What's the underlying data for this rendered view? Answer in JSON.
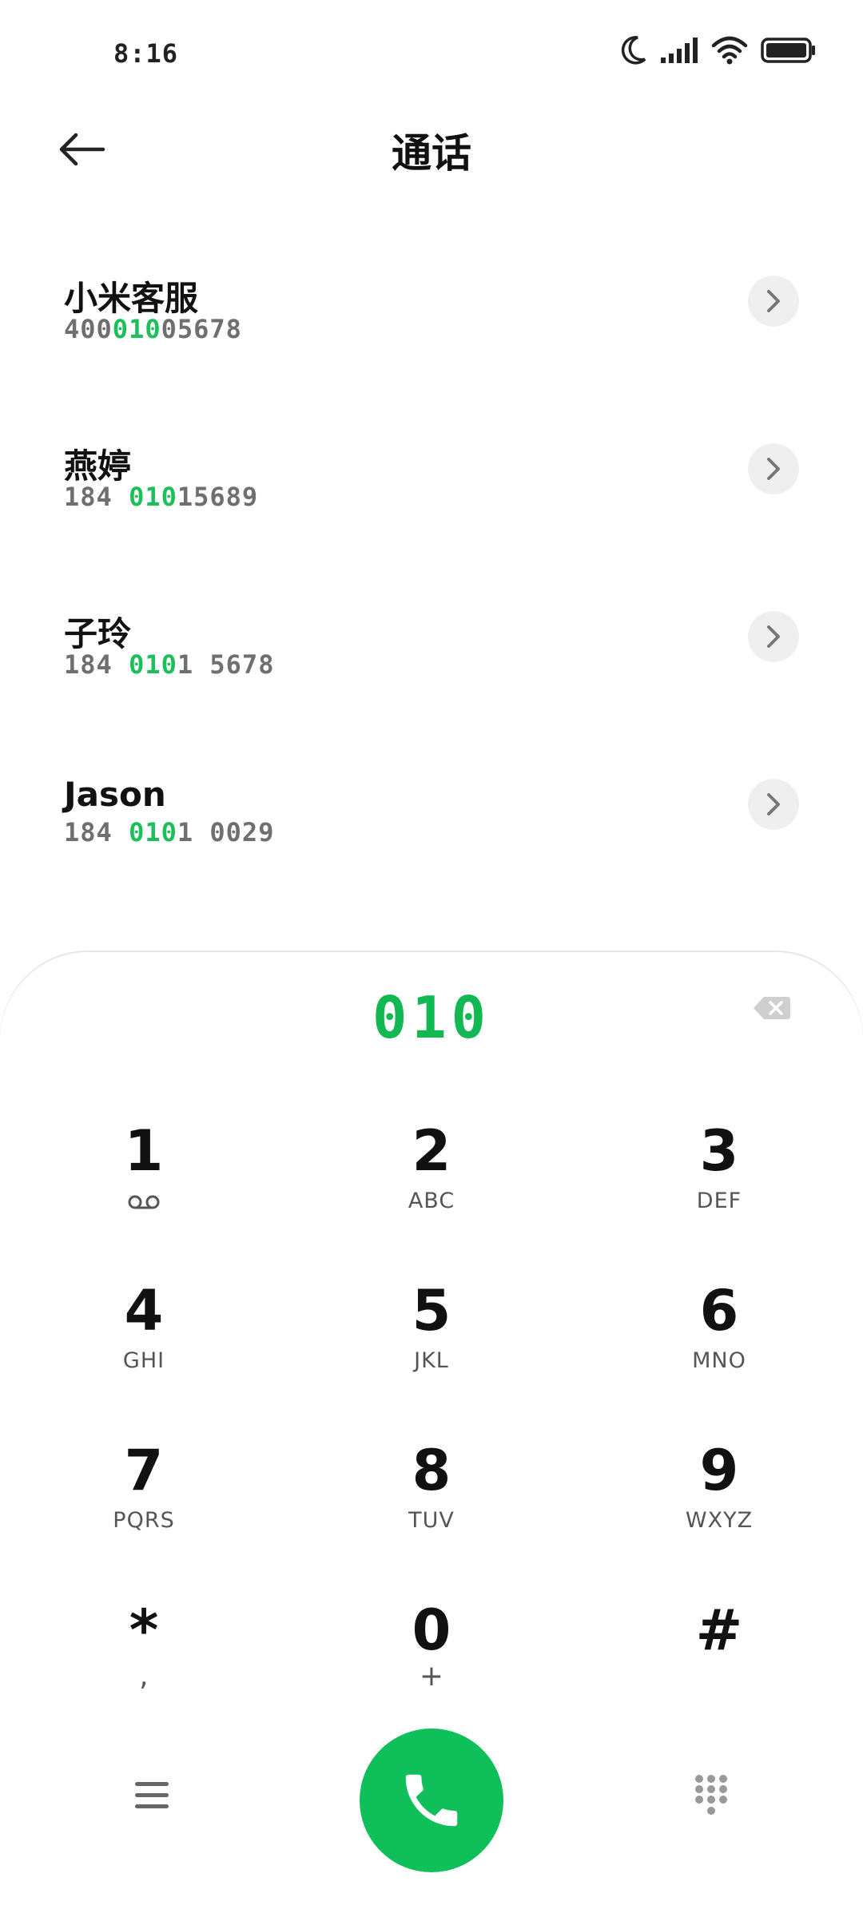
{
  "status_bar": {
    "time": "8:16",
    "icons": [
      "moon-icon",
      "signal-icon",
      "wifi-icon",
      "battery-icon"
    ]
  },
  "header": {
    "title": "通话",
    "back_icon": "back-arrow-icon"
  },
  "contacts": [
    {
      "name": "小米客服",
      "number_parts": [
        "400",
        "010",
        "05678"
      ]
    },
    {
      "name": "燕婷",
      "number_parts": [
        "184 ",
        "010",
        "15689"
      ]
    },
    {
      "name": "子玲",
      "number_parts": [
        "184 ",
        "010",
        "1 5678"
      ]
    },
    {
      "name": "Jason",
      "number_parts": [
        "184 ",
        "010",
        "1 0029"
      ]
    }
  ],
  "dialpad": {
    "dialed": "010",
    "keys": [
      {
        "digit": "1",
        "sub": "voicemail-icon"
      },
      {
        "digit": "2",
        "sub": "ABC"
      },
      {
        "digit": "3",
        "sub": "DEF"
      },
      {
        "digit": "4",
        "sub": "GHI"
      },
      {
        "digit": "5",
        "sub": "JKL"
      },
      {
        "digit": "6",
        "sub": "MNO"
      },
      {
        "digit": "7",
        "sub": "PQRS"
      },
      {
        "digit": "8",
        "sub": "TUV"
      },
      {
        "digit": "9",
        "sub": "WXYZ"
      },
      {
        "digit": "*",
        "sub": ","
      },
      {
        "digit": "0",
        "sub": "+"
      },
      {
        "digit": "#",
        "sub": ""
      }
    ]
  },
  "colors": {
    "accent": "#12b851",
    "call_button": "#0fbf59",
    "secondary_text": "#6f6f6f"
  }
}
